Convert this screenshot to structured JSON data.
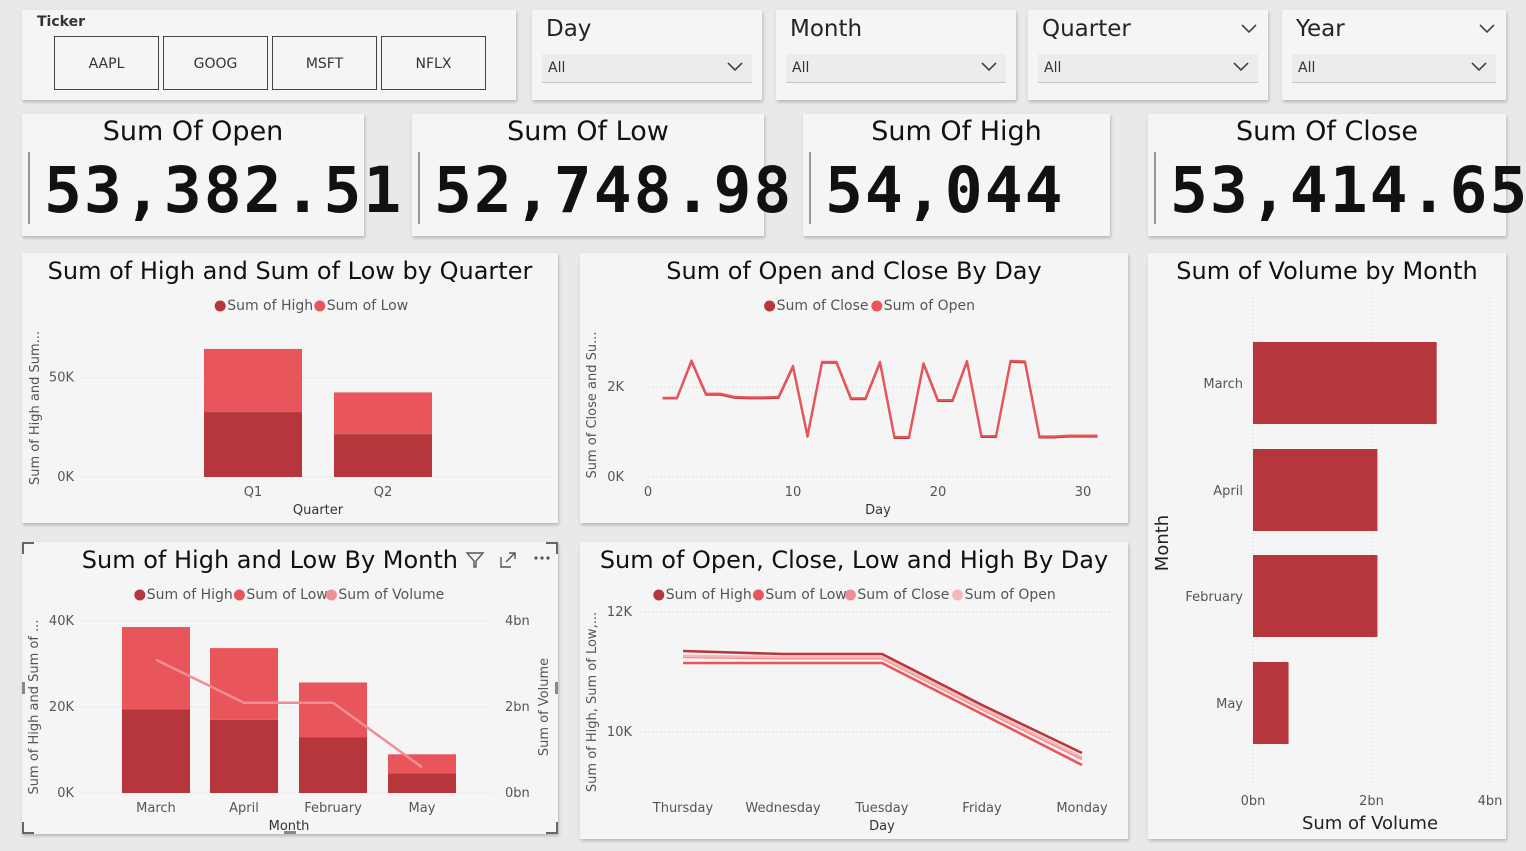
{
  "slicers": {
    "ticker": {
      "label": "Ticker",
      "buttons": [
        "AAPL",
        "GOOG",
        "MSFT",
        "NFLX"
      ]
    },
    "day": {
      "label": "Day",
      "value": "All"
    },
    "month": {
      "label": "Month",
      "value": "All"
    },
    "quarter": {
      "label": "Quarter",
      "value": "All"
    },
    "year": {
      "label": "Year",
      "value": "All"
    }
  },
  "kpis": {
    "open": {
      "title": "Sum Of Open",
      "value": "53,382.51"
    },
    "low": {
      "title": "Sum Of Low",
      "value": "52,748.98"
    },
    "high": {
      "title": "Sum Of High",
      "value": "54,044"
    },
    "close": {
      "title": "Sum Of Close",
      "value": "53,414.65"
    }
  },
  "colors": {
    "dark": "#b5373c",
    "mid": "#e8555b",
    "light": "#f08f93",
    "lighter": "#f7b7b9"
  },
  "chart_data": [
    {
      "type": "bar",
      "title": "Sum of High and Sum of Low by Quarter",
      "xlabel": "Quarter",
      "ylabel": "Sum of High and Sum...",
      "legend": [
        "Sum of High",
        "Sum of Low"
      ],
      "categories": [
        "Q1",
        "Q2"
      ],
      "series": [
        {
          "name": "Sum of High",
          "values": [
            32700,
            21600
          ]
        },
        {
          "name": "Sum of Low",
          "values": [
            31800,
            21000
          ]
        }
      ],
      "yticks": [
        "0K",
        "50K"
      ],
      "ylim": [
        0,
        70000
      ],
      "stacked": true
    },
    {
      "type": "line",
      "title": "Sum of Open and Close By Day",
      "xlabel": "Day",
      "ylabel": "Sum of Close and Su...",
      "legend": [
        "Sum of Close",
        "Sum of Open"
      ],
      "xticks": [
        "0",
        "10",
        "20",
        "30"
      ],
      "yticks": [
        "0K",
        "2K"
      ],
      "xlim": [
        0,
        32
      ],
      "ylim": [
        0,
        3200
      ],
      "series": [
        {
          "name": "Sum of Close",
          "x": [
            1,
            2,
            3,
            4,
            5,
            6,
            7,
            8,
            9,
            10,
            11,
            12,
            13,
            14,
            15,
            16,
            17,
            18,
            19,
            20,
            21,
            22,
            23,
            24,
            25,
            26,
            27,
            28,
            29,
            30,
            31
          ],
          "y": [
            1750,
            1750,
            2570,
            1830,
            1830,
            1760,
            1750,
            1750,
            1760,
            2450,
            900,
            2540,
            2540,
            1730,
            1730,
            2540,
            870,
            870,
            2510,
            1690,
            1690,
            2560,
            890,
            890,
            2560,
            2550,
            880,
            880,
            900,
            900,
            900
          ]
        },
        {
          "name": "Sum of Open",
          "x": [
            1,
            2,
            3,
            4,
            5,
            6,
            7,
            8,
            9,
            10,
            11,
            12,
            13,
            14,
            15,
            16,
            17,
            18,
            19,
            20,
            21,
            22,
            23,
            24,
            25,
            26,
            27,
            28,
            29,
            30,
            31
          ],
          "y": [
            1760,
            1760,
            2590,
            1850,
            1850,
            1780,
            1770,
            1770,
            1780,
            2470,
            920,
            2560,
            2560,
            1750,
            1750,
            2560,
            890,
            890,
            2530,
            1710,
            1710,
            2580,
            910,
            910,
            2580,
            2570,
            900,
            900,
            920,
            920,
            920
          ]
        }
      ]
    },
    {
      "type": "bar",
      "title": "Sum of Volume by Month",
      "xlabel": "Sum of Volume",
      "ylabel": "Month",
      "categories": [
        "March",
        "April",
        "February",
        "May"
      ],
      "values": [
        3.1,
        2.1,
        2.1,
        0.6
      ],
      "xticks": [
        "0bn",
        "2bn",
        "4bn"
      ],
      "xlim": [
        0,
        4
      ],
      "orientation": "horizontal"
    },
    {
      "type": "bar",
      "title": "Sum of High and Low By Month",
      "xlabel": "Month",
      "ylabel": "Sum of High and Sum of ...",
      "y2label": "Sum of Volume",
      "legend": [
        "Sum of High",
        "Sum of Low",
        "Sum of Volume"
      ],
      "categories": [
        "March",
        "April",
        "February",
        "May"
      ],
      "series": [
        {
          "name": "Sum of High",
          "values": [
            19500,
            17000,
            13000,
            4600
          ]
        },
        {
          "name": "Sum of Low",
          "values": [
            19100,
            16700,
            12700,
            4400
          ]
        },
        {
          "name": "Sum of Volume",
          "values": [
            3.1,
            2.1,
            2.1,
            0.6
          ]
        }
      ],
      "yticks": [
        "0K",
        "20K",
        "40K"
      ],
      "y2ticks": [
        "0bn",
        "2bn",
        "4bn"
      ],
      "ylim": [
        0,
        40000
      ],
      "y2lim": [
        0,
        4
      ],
      "stacked": true
    },
    {
      "type": "line",
      "title": "Sum of Open, Close, Low and High By Day",
      "xlabel": "Day",
      "ylabel": "Sum of High, Sum of Low,...",
      "legend": [
        "Sum of High",
        "Sum of Low",
        "Sum of Close",
        "Sum of Open"
      ],
      "categories": [
        "Thursday",
        "Wednesday",
        "Tuesday",
        "Friday",
        "Monday"
      ],
      "yticks": [
        "10K",
        "12K"
      ],
      "ylim": [
        9000,
        12000
      ],
      "series": [
        {
          "name": "Sum of High",
          "values": [
            11350,
            11300,
            11300,
            10450,
            9650
          ]
        },
        {
          "name": "Sum of Low",
          "values": [
            11150,
            11150,
            11150,
            10300,
            9450
          ]
        },
        {
          "name": "Sum of Close",
          "values": [
            11250,
            11230,
            11230,
            10380,
            9550
          ]
        },
        {
          "name": "Sum of Open",
          "values": [
            11270,
            11250,
            11250,
            10400,
            9580
          ]
        }
      ]
    }
  ]
}
